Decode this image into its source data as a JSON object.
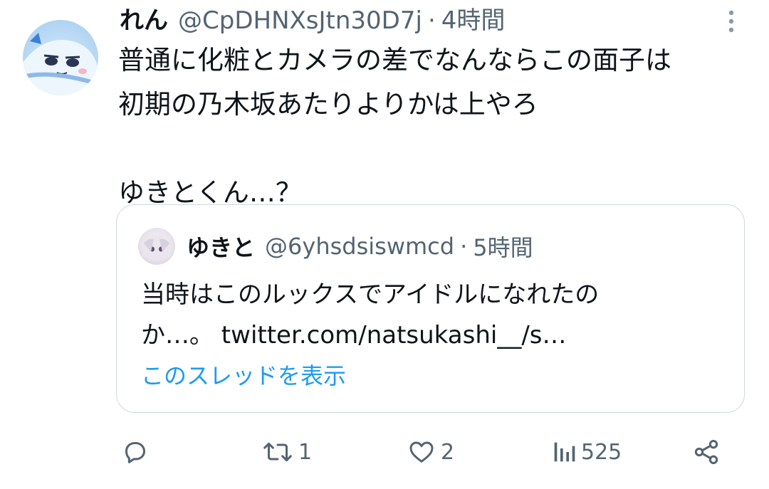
{
  "tweet": {
    "display_name": "れん",
    "handle": "@CpDHNXsJtn30D7j",
    "separator": "·",
    "time": "4時間",
    "text": "普通に化粧とカメラの差でなんならこの面子は\n初期の乃木坂あたりよりかは上やろ\n\nゆきとくん…？"
  },
  "quote": {
    "display_name": "ゆきと",
    "handle": "@6yhsdsiswmcd",
    "separator": "·",
    "time": "5時間",
    "text": "当時はこのルックスでアイドルになれたの\nか…。 twitter.com/natsukashi__/s…",
    "thread_link": "このスレッドを表示"
  },
  "actions": {
    "reply": {
      "icon": "reply-icon",
      "count": ""
    },
    "retweet": {
      "icon": "retweet-icon",
      "count": "1"
    },
    "like": {
      "icon": "heart-icon",
      "count": "2"
    },
    "views": {
      "icon": "views-icon",
      "count": "525"
    },
    "share": {
      "icon": "share-icon"
    }
  },
  "colors": {
    "text": "#0f1419",
    "muted": "#536471",
    "link": "#1d9bf0",
    "border": "#cfd9de"
  }
}
